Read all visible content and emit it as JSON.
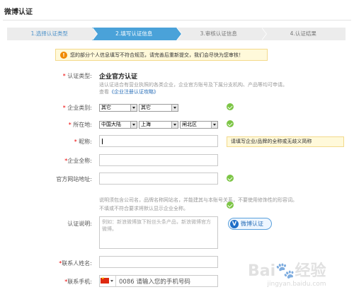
{
  "page": {
    "title": "微博认证"
  },
  "steps": [
    {
      "label": "1.选择认证类型",
      "state": "done"
    },
    {
      "label": "2.填写认证信息",
      "state": "active"
    },
    {
      "label": "3.审核认证信息",
      "state": "todo"
    },
    {
      "label": "4.认证结果",
      "state": "todo"
    }
  ],
  "notice": {
    "text": "您的部分个人信息填写不符合规范，请完善后重新提交，我们会尽快为您审核！"
  },
  "form": {
    "type": {
      "label": "认证类型:",
      "value": "企业官方认证",
      "desc": "适认证适合有营业执照的各类企业，企业官方账号及下属分支机构、产品等均可申请。",
      "link_prefix": "查看",
      "link": "《企业注册认证攻略》"
    },
    "category": {
      "label": "企业类别:",
      "select1": "其它",
      "select2": "其它"
    },
    "location": {
      "label": "所在地:",
      "country": "中国大陆",
      "province": "上海",
      "district": "闸北区"
    },
    "nickname": {
      "label": "昵称:",
      "tip": "请填写企业/品牌的全称或无歧义简称"
    },
    "fullname": {
      "label": "企业全称:"
    },
    "website": {
      "label": "官方网站地址:"
    },
    "desc": {
      "label": "认证说明:",
      "hint1": "说明须包含公司名，品牌名称网站名，并能建其与本账号关系，不要使用修饰性的形容词。",
      "hint2": "不填或不符合要求将默认显示企业全称。",
      "placeholder": "例如：新浪微博旗下粉丝头条产品，新浪微博官方微博。",
      "badge": "微博认证"
    },
    "contact": {
      "label": "联系人姓名:"
    },
    "phone": {
      "label": "联系手机:",
      "placeholder": "0086 请输入您的手机号码"
    }
  },
  "watermark": {
    "brand": "Bai🐾经验",
    "url": "jingyan.baidu.com"
  },
  "colors": {
    "accent": "#4aa2d9",
    "check": "#7cc545",
    "required": "#e00000"
  }
}
